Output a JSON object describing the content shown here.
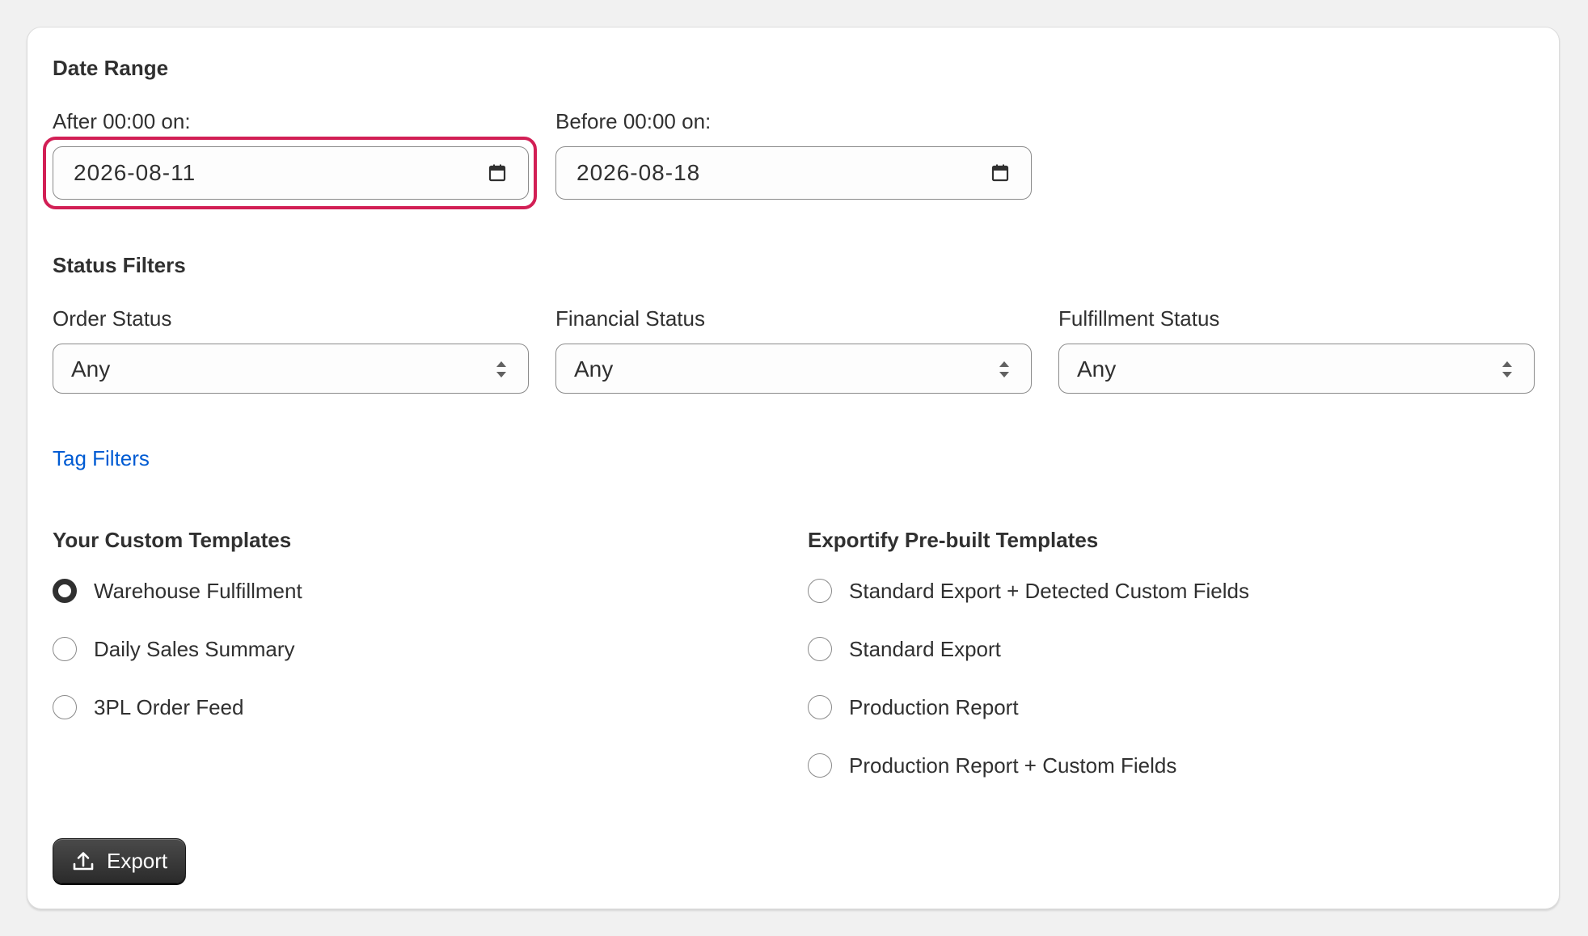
{
  "date_range": {
    "heading": "Date Range",
    "after_label": "After 00:00 on:",
    "after_value": "2026-08-11",
    "before_label": "Before 00:00 on:",
    "before_value": "2026-08-18"
  },
  "status_filters": {
    "heading": "Status Filters",
    "order_label": "Order Status",
    "order_value": "Any",
    "financial_label": "Financial Status",
    "financial_value": "Any",
    "fulfillment_label": "Fulfillment Status",
    "fulfillment_value": "Any"
  },
  "tag_filters": {
    "label": "Tag Filters"
  },
  "custom_templates": {
    "heading": "Your Custom Templates",
    "items": [
      {
        "label": "Warehouse Fulfillment",
        "selected": true
      },
      {
        "label": "Daily Sales Summary",
        "selected": false
      },
      {
        "label": "3PL Order Feed",
        "selected": false
      }
    ]
  },
  "prebuilt_templates": {
    "heading": "Exportify Pre-built Templates",
    "items": [
      {
        "label": "Standard Export + Detected Custom Fields",
        "selected": false
      },
      {
        "label": "Standard Export",
        "selected": false
      },
      {
        "label": "Production Report",
        "selected": false
      },
      {
        "label": "Production Report + Custom Fields",
        "selected": false
      }
    ]
  },
  "export_button": {
    "label": "Export"
  },
  "colors": {
    "focus_ring": "#d21f55",
    "link": "#005bd3",
    "button_bg": "#303030"
  }
}
